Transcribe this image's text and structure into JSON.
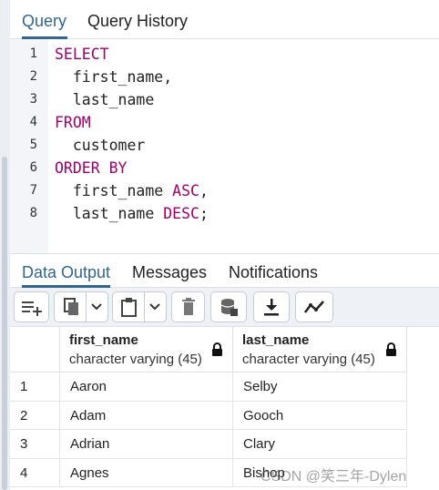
{
  "query_tabs": {
    "query": "Query",
    "history": "Query History"
  },
  "editor": {
    "line_numbers": [
      "1",
      "2",
      "3",
      "4",
      "5",
      "6",
      "7",
      "8"
    ],
    "lines": [
      {
        "kw": "SELECT",
        "text": ""
      },
      {
        "kw": "",
        "text": "  first_name,"
      },
      {
        "kw": "",
        "text": "  last_name"
      },
      {
        "kw": "FROM",
        "text": ""
      },
      {
        "kw": "",
        "text": "  customer"
      },
      {
        "kw": "ORDER BY",
        "text": ""
      },
      {
        "pre": "  first_name ",
        "kw": "ASC",
        "text": ","
      },
      {
        "pre": "  last_name ",
        "kw": "DESC",
        "text": ";"
      }
    ]
  },
  "output_tabs": {
    "data_output": "Data Output",
    "messages": "Messages",
    "notifications": "Notifications"
  },
  "grid": {
    "columns": [
      {
        "name": "first_name",
        "type": "character varying (45)"
      },
      {
        "name": "last_name",
        "type": "character varying (45)"
      }
    ],
    "rows": [
      {
        "n": "1",
        "first": "Aaron",
        "last": "Selby"
      },
      {
        "n": "2",
        "first": "Adam",
        "last": "Gooch"
      },
      {
        "n": "3",
        "first": "Adrian",
        "last": "Clary"
      },
      {
        "n": "4",
        "first": "Agnes",
        "last": "Bishop"
      }
    ]
  },
  "icons": {
    "add_row": "add-row-icon",
    "copy": "copy-icon",
    "paste": "paste-icon",
    "delete": "trash-icon",
    "save_data": "database-save-icon",
    "download": "download-icon",
    "graph": "graph-icon"
  },
  "watermark": "CSDN @笑三年-Dylen",
  "colors": {
    "accent": "#326690",
    "keyword": "#a0006e"
  }
}
